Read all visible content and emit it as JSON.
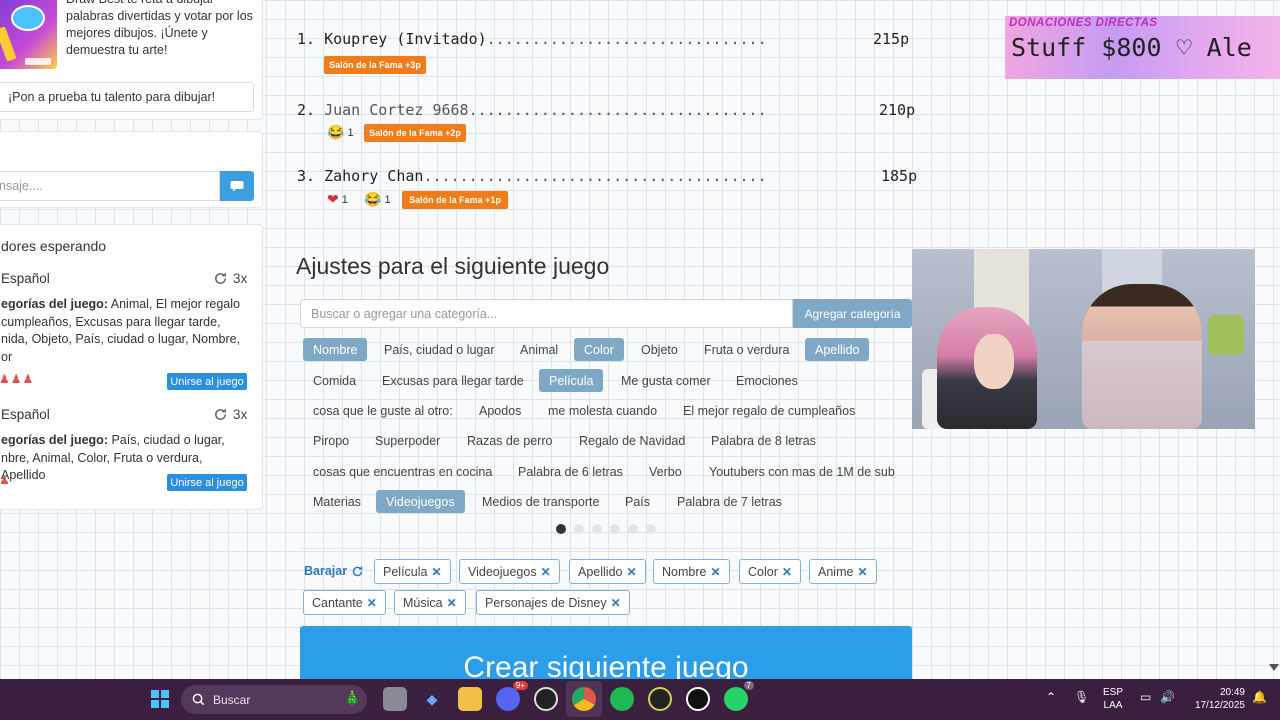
{
  "promo": {
    "text": "Draw Best te reta a dibujar palabras divertidas y votar por los mejores dibujos. ¡Únete y demuestra tu arte!",
    "button": "¡Pon a prueba tu talento para dibujar!"
  },
  "chat": {
    "placeholder": "nsaje...."
  },
  "waiting": {
    "title": "dores esperando",
    "games": [
      {
        "language": "Español",
        "multiplier": "3x",
        "categories_label": "egorías del juego:",
        "categories": " Animal, El mejor regalo cumpleaños, Excusas para llegar tarde, nida, Objeto, País, ciudad o lugar, Nombre, or",
        "players": "♟♟♟",
        "join": "Unirse al juego"
      },
      {
        "language": "Español",
        "multiplier": "3x",
        "categories_label": "egorías del juego:",
        "categories": " País, ciudad o lugar, nbre, Animal, Color, Fruta o verdura, Apellido",
        "players": "♟",
        "join": "Unirse al juego"
      }
    ]
  },
  "ranking": [
    {
      "pos": "1.",
      "name": "Kouprey (Invitado)",
      "dots": "...............................",
      "points": "215p",
      "reactions": [],
      "fame": "Salón de la Fama +3p"
    },
    {
      "pos": "2.",
      "name": "Juan Cortez 9668",
      "dots": ".................................",
      "points": "210p",
      "reactions": [
        {
          "emoji": "😂",
          "count": "1"
        }
      ],
      "fame": "Salón de la Fama +2p"
    },
    {
      "pos": "3.",
      "name": "Zahory Chan",
      "dots": "......................................",
      "points": "185p",
      "reactions": [
        {
          "emoji": "❤",
          "count": "1"
        },
        {
          "emoji": "😂",
          "count": "1"
        }
      ],
      "fame": "Salón de la Fama +1p"
    }
  ],
  "settings": {
    "title": "Ajustes para el siguiente juego",
    "search_placeholder": "Buscar o agregar una categoría...",
    "add_button": "Agregar categoría",
    "categories": [
      {
        "label": "Nombre",
        "selected": true
      },
      {
        "label": "País, ciudad o lugar",
        "selected": false
      },
      {
        "label": "Animal",
        "selected": false
      },
      {
        "label": "Color",
        "selected": true
      },
      {
        "label": "Objeto",
        "selected": false
      },
      {
        "label": "Fruta o verdura",
        "selected": false
      },
      {
        "label": "Apellido",
        "selected": true
      },
      {
        "label": "Comida",
        "selected": false
      },
      {
        "label": "Excusas para llegar tarde",
        "selected": false
      },
      {
        "label": "Película",
        "selected": true
      },
      {
        "label": "Me gusta comer",
        "selected": false
      },
      {
        "label": "Emociones",
        "selected": false
      },
      {
        "label": "cosa que le guste al otro:",
        "selected": false
      },
      {
        "label": "Apodos",
        "selected": false
      },
      {
        "label": "me molesta cuando",
        "selected": false
      },
      {
        "label": "El mejor regalo de cumpleaños",
        "selected": false
      },
      {
        "label": "Piropo",
        "selected": false
      },
      {
        "label": "Superpoder",
        "selected": false
      },
      {
        "label": "Razas de perro",
        "selected": false
      },
      {
        "label": "Regalo de Navidad",
        "selected": false
      },
      {
        "label": "Palabra de 8 letras",
        "selected": false
      },
      {
        "label": "cosas que encuentras en cocina",
        "selected": false
      },
      {
        "label": "Palabra de 6 letras",
        "selected": false
      },
      {
        "label": "Verbo",
        "selected": false
      },
      {
        "label": "Youtubers con mas de 1M de sub",
        "selected": false
      },
      {
        "label": "Materias",
        "selected": false
      },
      {
        "label": "Videojuegos",
        "selected": true
      },
      {
        "label": "Medios de transporte",
        "selected": false
      },
      {
        "label": "País",
        "selected": false
      },
      {
        "label": "Palabra de 7 letras",
        "selected": false
      }
    ],
    "pager_current": 1,
    "pager_total": 6,
    "shuffle_label": "Barajar",
    "chosen": [
      "Película",
      "Videojuegos",
      "Apellido",
      "Nombre",
      "Color",
      "Anime",
      "Cantante",
      "Música",
      "Personajes de Disney"
    ],
    "create_button": "Crear siguiente juego"
  },
  "donation": {
    "title": "DONACIONES DIRECTAS",
    "text": "Stuff $800  ♡  Ale"
  },
  "taskbar": {
    "search": "Buscar",
    "lang_top": "ESP",
    "lang_bottom": "LAA",
    "time": "20:49",
    "date": "17/12/2025",
    "discord_badge": "9+",
    "whatsapp_badge": "7"
  },
  "colors": {
    "accent": "#7fa8c6",
    "primary": "#2c9de8",
    "fame": "#f07d1a",
    "taskbar": "#3a1f3e"
  }
}
